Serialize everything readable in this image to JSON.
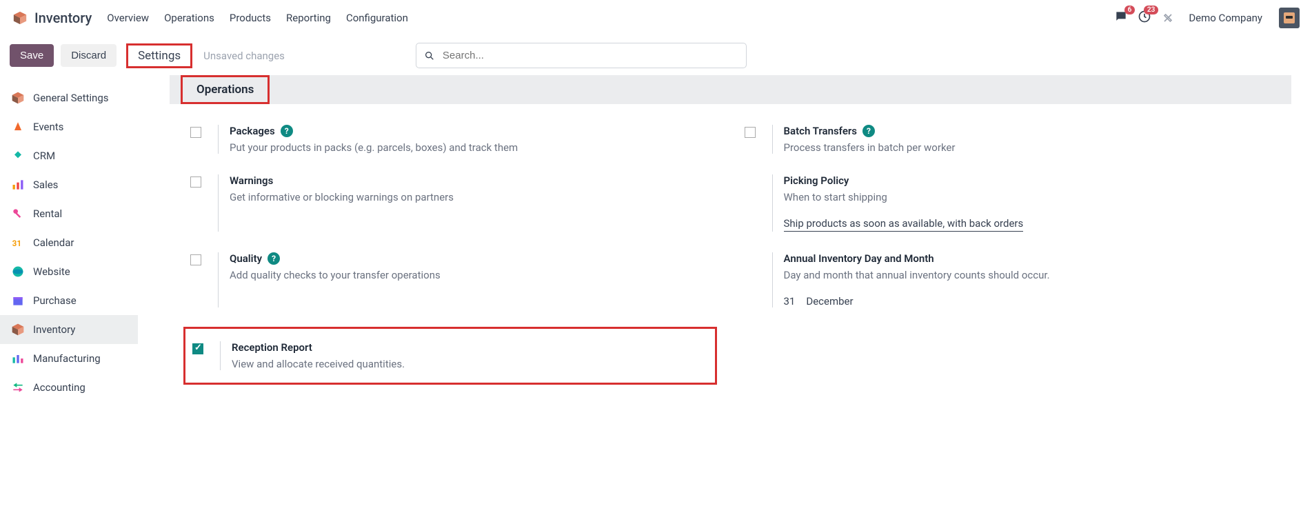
{
  "app": {
    "title": "Inventory"
  },
  "topnav": [
    "Overview",
    "Operations",
    "Products",
    "Reporting",
    "Configuration"
  ],
  "badges": {
    "messages": "6",
    "activities": "23"
  },
  "company": "Demo Company",
  "actions": {
    "save": "Save",
    "discard": "Discard"
  },
  "breadcrumb": {
    "settings": "Settings",
    "unsaved": "Unsaved changes"
  },
  "search": {
    "placeholder": "Search..."
  },
  "sidebar": {
    "items": [
      {
        "label": "General Settings"
      },
      {
        "label": "Events"
      },
      {
        "label": "CRM"
      },
      {
        "label": "Sales"
      },
      {
        "label": "Rental"
      },
      {
        "label": "Calendar"
      },
      {
        "label": "Website"
      },
      {
        "label": "Purchase"
      },
      {
        "label": "Inventory"
      },
      {
        "label": "Manufacturing"
      },
      {
        "label": "Accounting"
      }
    ]
  },
  "section": {
    "title": "Operations"
  },
  "settings": {
    "packages": {
      "title": "Packages",
      "desc": "Put your products in packs (e.g. parcels, boxes) and track them"
    },
    "batch": {
      "title": "Batch Transfers",
      "desc": "Process transfers in batch per worker"
    },
    "warnings": {
      "title": "Warnings",
      "desc": "Get informative or blocking warnings on partners"
    },
    "picking": {
      "title": "Picking Policy",
      "desc": "When to start shipping",
      "value": "Ship products as soon as available, with back orders"
    },
    "quality": {
      "title": "Quality",
      "desc": "Add quality checks to your transfer operations"
    },
    "annual": {
      "title": "Annual Inventory Day and Month",
      "desc": "Day and month that annual inventory counts should occur.",
      "day": "31",
      "month": "December"
    },
    "reception": {
      "title": "Reception Report",
      "desc": "View and allocate received quantities."
    }
  }
}
